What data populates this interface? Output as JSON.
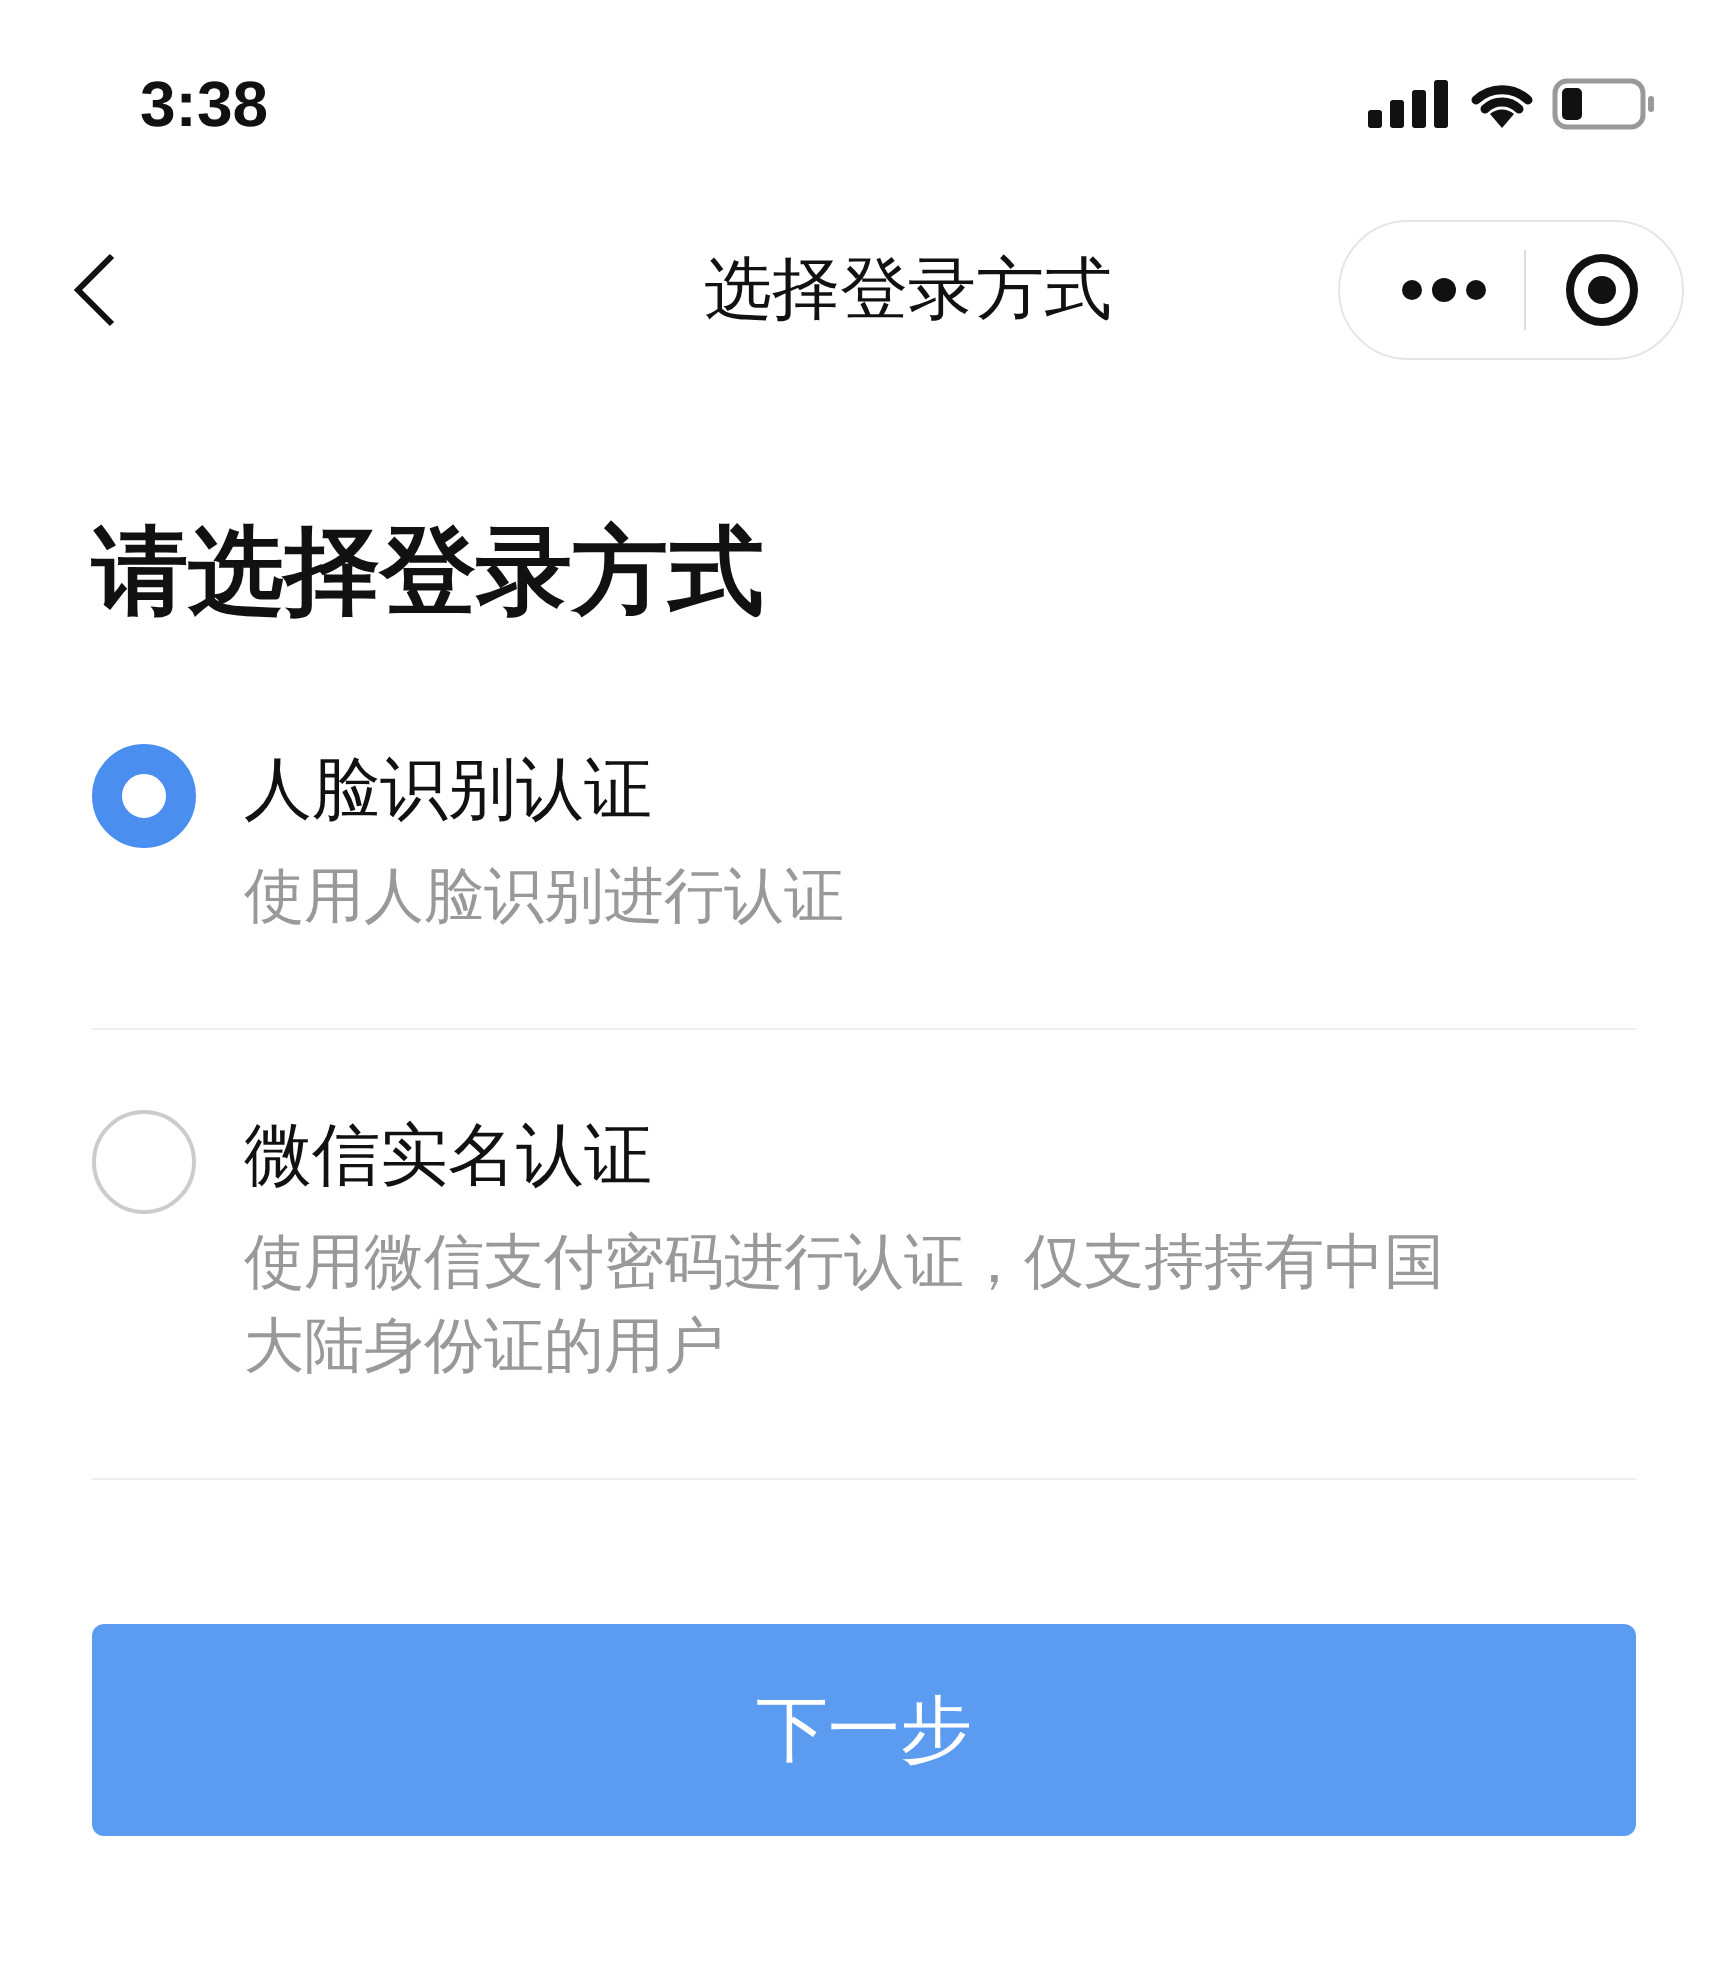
{
  "status_bar": {
    "time": "3:38"
  },
  "nav_bar": {
    "title": "选择登录方式"
  },
  "heading": "请选择登录方式",
  "options": [
    {
      "title": "人脸识别认证",
      "description": "使用人脸识别进行认证",
      "selected": true
    },
    {
      "title": "微信实名认证",
      "description": "使用微信支付密码进行认证，仅支持持有中国大陆身份证的用户",
      "selected": false
    }
  ],
  "next_button": "下一步"
}
